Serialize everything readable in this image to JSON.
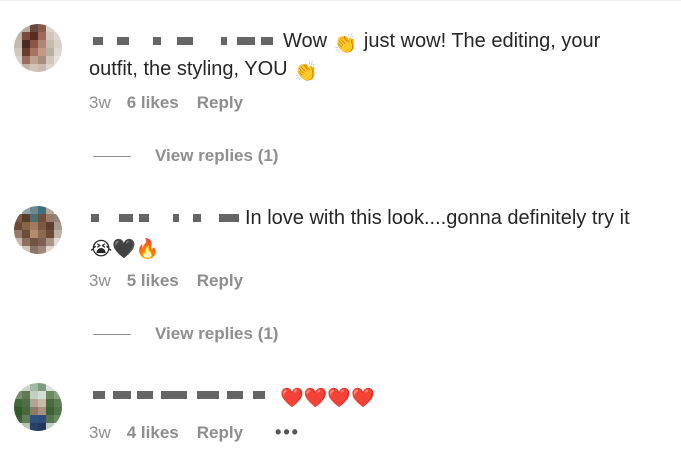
{
  "comments": [
    {
      "text": "Wow 👏 just wow! The editing, your outfit, the styling, YOU 👏",
      "text_part1": "Wow",
      "emoji1": "👏",
      "text_part2": "just wow! The editing, your",
      "text_line2": "outfit, the styling, YOU",
      "emoji2": "👏",
      "time": "3w",
      "likes": "6 likes",
      "reply": "Reply",
      "view_replies": "View replies (1)"
    },
    {
      "text": "In love with this look....gonna definitely try it 😭🖤🔥",
      "text_part1": "In love with this look....gonna definitely try it",
      "emojis": "😭🖤🔥",
      "time": "3w",
      "likes": "5 likes",
      "reply": "Reply",
      "view_replies": "View replies (1)"
    },
    {
      "emojis": "❤️❤️❤️❤️",
      "time": "3w",
      "likes": "4 likes",
      "reply": "Reply",
      "more": "•••"
    }
  ],
  "colors": {
    "text": "#262626",
    "secondary": "#8e8e8e"
  },
  "icons": [
    "clapping-hands-icon",
    "crying-face-icon",
    "black-heart-icon",
    "fire-icon",
    "red-heart-icon",
    "more-options-icon"
  ]
}
